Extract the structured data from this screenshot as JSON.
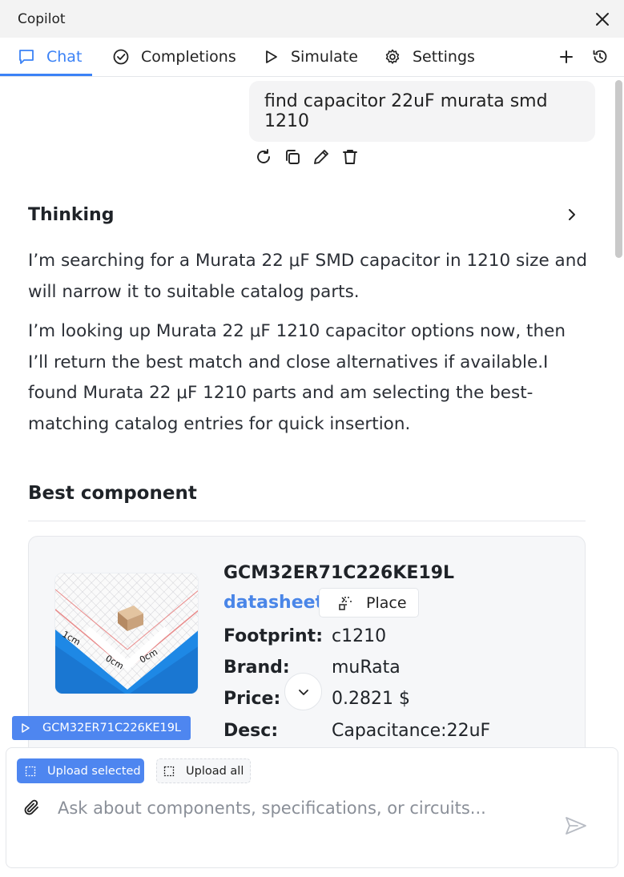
{
  "window": {
    "title": "Copilot"
  },
  "tabs": [
    {
      "label": "Chat",
      "icon": "chat-icon",
      "active": true
    },
    {
      "label": "Completions",
      "icon": "check-circle-icon",
      "active": false
    },
    {
      "label": "Simulate",
      "icon": "play-icon",
      "active": false
    },
    {
      "label": "Settings",
      "icon": "gear-icon",
      "active": false
    }
  ],
  "user_message": "find capacitor 22uF murata smd 1210",
  "message_actions": [
    "refresh-icon",
    "copy-icon",
    "edit-icon",
    "trash-icon"
  ],
  "thinking": {
    "label": "Thinking"
  },
  "response": {
    "para1": "I’m searching for a Murata 22 μF SMD capacitor in 1210 size and will narrow it to suitable catalog parts.",
    "para2": "I’m looking up Murata 22 μF 1210 capacitor options now, then I’ll return the best match and close alternatives if available.I found Murata 22 μF 1210 parts and am selecting the best-matching catalog entries for quick insertion."
  },
  "best_component": {
    "section_title": "Best component",
    "part_number": "GCM32ER71C226KE19L",
    "datasheet_label": "datasheet",
    "place_label": "Place",
    "thumb_labels": {
      "left": "1cm",
      "mid": "0cm",
      "right": "0cm"
    },
    "specs": [
      {
        "key": "Footprint:",
        "value": "c1210"
      },
      {
        "key": "Brand:",
        "value": "muRata"
      },
      {
        "key": "Price:",
        "value": "0.2821 $"
      },
      {
        "key": "Desc:",
        "value": "Capacitance:22uF"
      }
    ]
  },
  "selected_chip": {
    "label": "GCM32ER71C226KE19L"
  },
  "composer": {
    "upload_selected": "Upload selected",
    "upload_all": "Upload all",
    "placeholder": "Ask about components, specifications, or circuits..."
  },
  "colors": {
    "accent": "#3b82f6",
    "chip": "#4e86f0",
    "link": "#4a86e8"
  }
}
